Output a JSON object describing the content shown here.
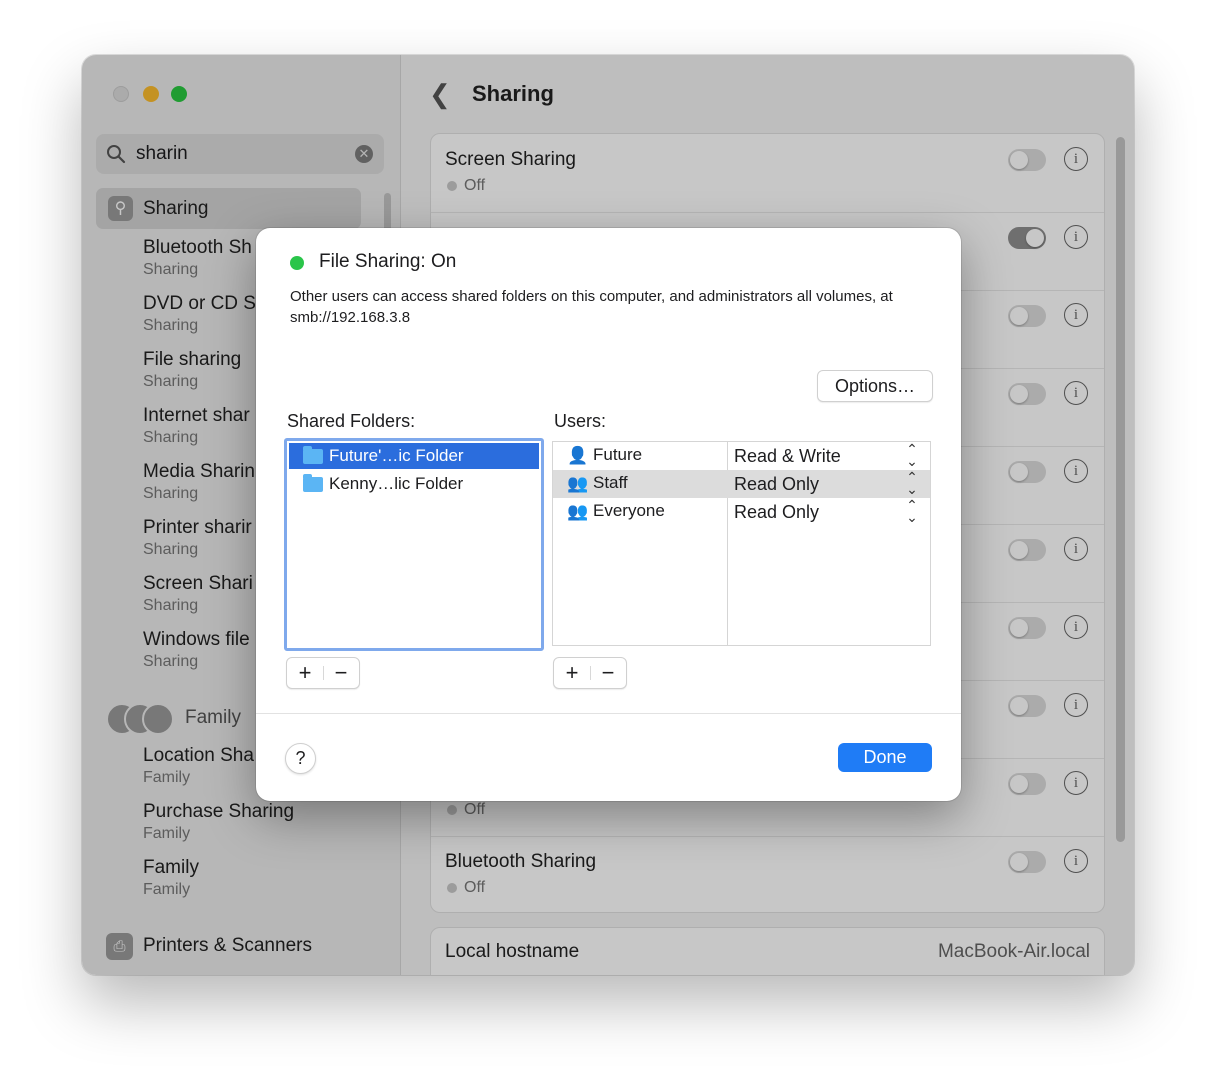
{
  "sidebar": {
    "search": {
      "value": "sharin"
    },
    "selected": {
      "label": "Sharing"
    },
    "items": [
      {
        "title": "Bluetooth Sh",
        "subtitle": "Sharing"
      },
      {
        "title": "DVD or CD S",
        "subtitle": "Sharing"
      },
      {
        "title": "File sharing",
        "subtitle": "Sharing"
      },
      {
        "title": "Internet shar",
        "subtitle": "Sharing"
      },
      {
        "title": "Media Sharin",
        "subtitle": "Sharing"
      },
      {
        "title": "Printer sharir",
        "subtitle": "Sharing"
      },
      {
        "title": "Screen Shari",
        "subtitle": "Sharing"
      },
      {
        "title": "Windows file",
        "subtitle": "Sharing"
      }
    ],
    "family_section": {
      "label": "Family"
    },
    "family_items": [
      {
        "title": "Location Sha",
        "subtitle": "Family"
      },
      {
        "title": "Purchase Sharing",
        "subtitle": "Family"
      },
      {
        "title": "Family",
        "subtitle": "Family"
      }
    ],
    "printers": {
      "label": "Printers & Scanners"
    }
  },
  "main": {
    "title": "Sharing",
    "rows": [
      {
        "name": "Screen Sharing",
        "status": "Off",
        "on": false
      },
      {
        "name": "",
        "status": "",
        "on": true
      },
      {
        "name": "",
        "status": "",
        "on": false
      },
      {
        "name": "",
        "status": "",
        "on": false
      },
      {
        "name": "",
        "status": "",
        "on": false
      },
      {
        "name": "",
        "status": "",
        "on": false
      },
      {
        "name": "",
        "status": "",
        "on": false
      },
      {
        "name": "",
        "status": "",
        "on": false
      },
      {
        "name": "",
        "status": "Off",
        "on": false
      },
      {
        "name": "Bluetooth Sharing",
        "status": "Off",
        "on": false
      }
    ],
    "hostname": {
      "label": "Local hostname",
      "value": "MacBook-Air.local"
    }
  },
  "modal": {
    "title": "File Sharing: On",
    "description": "Other users can access shared folders on this computer, and administrators all volumes, at smb://192.168.3.8",
    "options_label": "Options…",
    "shared_folders_label": "Shared Folders:",
    "folders": [
      {
        "name": "Future'…ic Folder",
        "selected": true
      },
      {
        "name": "Kenny…lic Folder",
        "selected": false
      }
    ],
    "users_label": "Users:",
    "users": [
      {
        "name": "Future",
        "permission": "Read & Write",
        "icon": "single-user-icon"
      },
      {
        "name": "Staff",
        "permission": "Read Only",
        "icon": "group-icon"
      },
      {
        "name": "Everyone",
        "permission": "Read Only",
        "icon": "everyone-icon"
      }
    ],
    "plus": "+",
    "minus": "−",
    "help": "?",
    "done_label": "Done"
  },
  "colors": {
    "accent": "#1f7cf6",
    "status_on": "#2ac54a",
    "selection": "#2b6ddd"
  }
}
